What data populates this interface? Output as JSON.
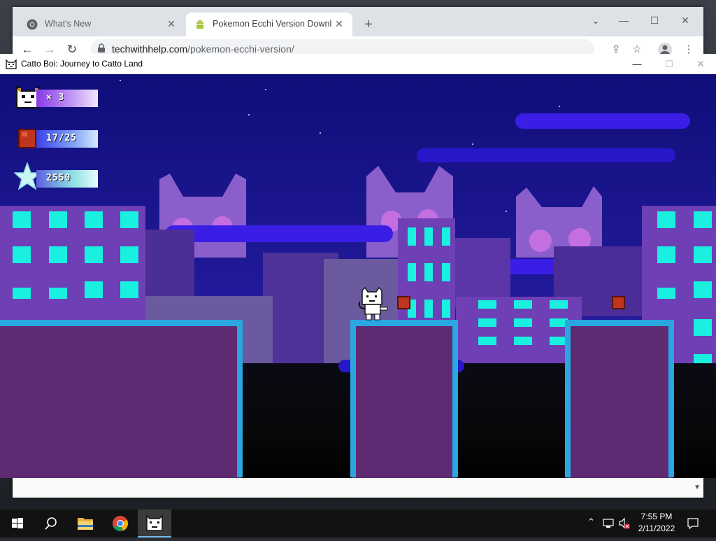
{
  "browser": {
    "tabs": [
      {
        "title": "What's New",
        "active": false,
        "icon": "chrome-favicon-icon"
      },
      {
        "title": "Pokemon Ecchi Version Downloa",
        "active": true,
        "icon": "android-favicon-icon"
      }
    ],
    "new_tab_label": "+",
    "url_host": "techwithhelp.com",
    "url_path": "/pokemon-ecchi-version/"
  },
  "game_window": {
    "title": "Catto Boi: Journey to Catto Land",
    "hud": {
      "lives": "× 3",
      "coins": "17/25",
      "score": "2550"
    }
  },
  "taskbar": {
    "time": "7:55 PM",
    "date": "2/11/2022"
  },
  "colors": {
    "sky_top": "#0f0e7a",
    "platform_fill": "#5e2a72",
    "platform_edge": "#2aa6e0",
    "window_cyan": "#19f0e0",
    "building_purple": "#6e3fb5",
    "cat_silhouette": "#8a5fcc"
  }
}
